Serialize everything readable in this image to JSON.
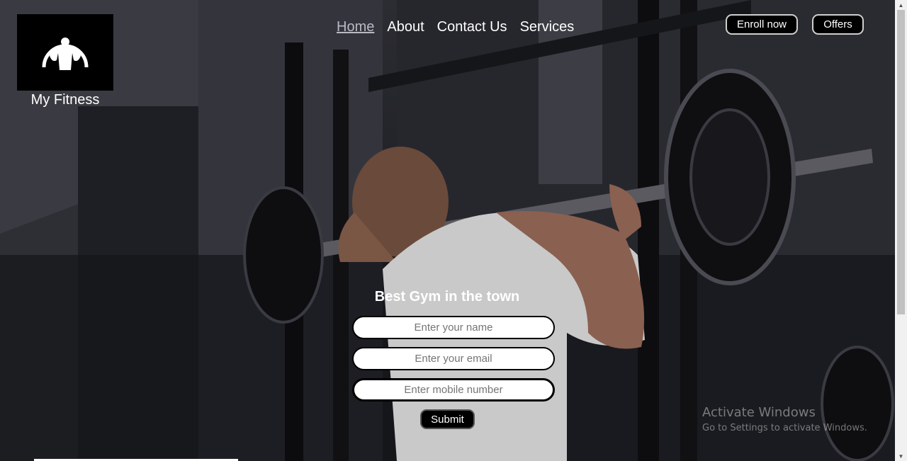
{
  "brand": {
    "name": "My Fitness",
    "logo_icon": "bodybuilder-icon"
  },
  "nav": {
    "items": [
      {
        "label": "Home",
        "active": true
      },
      {
        "label": "About",
        "active": false
      },
      {
        "label": "Contact Us",
        "active": false
      },
      {
        "label": "Services",
        "active": false
      }
    ]
  },
  "header_buttons": {
    "enroll_label": "Enroll now",
    "offers_label": "Offers"
  },
  "form": {
    "title": "Best Gym in the town",
    "name_placeholder": "Enter your name",
    "email_placeholder": "Enter your email",
    "mobile_placeholder": "Enter mobile number",
    "submit_label": "Submit"
  },
  "watermark": {
    "line1": "Activate Windows",
    "line2": "Go to Settings to activate Windows."
  },
  "colors": {
    "accent": "#ffffff",
    "button_bg": "#000000",
    "nav_active": "#b9b9c4"
  }
}
